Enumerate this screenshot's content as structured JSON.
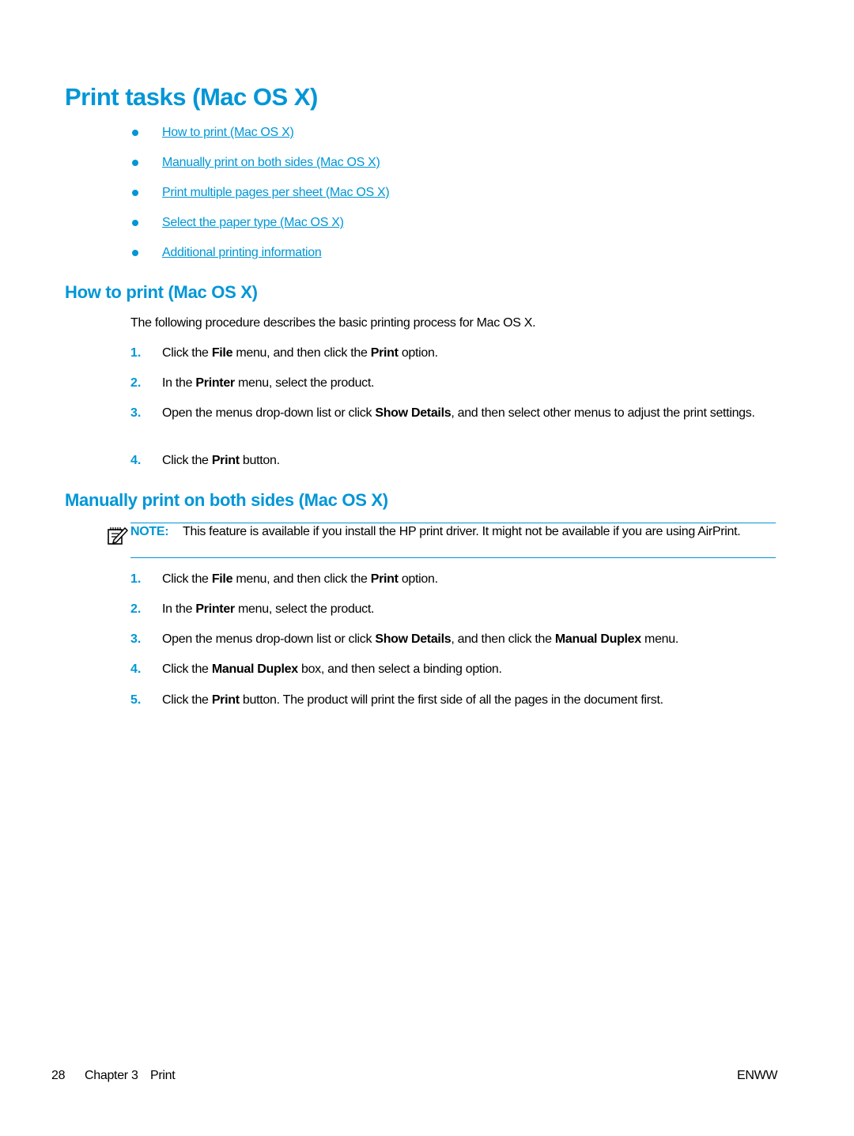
{
  "page": {
    "title": "Print tasks (Mac OS X)",
    "toc": [
      {
        "label": "How to print (Mac OS X)"
      },
      {
        "label": "Manually print on both sides (Mac OS X)"
      },
      {
        "label": "Print multiple pages per sheet (Mac OS X)"
      },
      {
        "label": "Select the paper type (Mac OS X)"
      },
      {
        "label": "Additional printing information"
      }
    ]
  },
  "section1": {
    "heading": "How to print (Mac OS X)",
    "intro": "The following procedure describes the basic printing process for Mac OS X.",
    "steps": [
      {
        "num": "1.",
        "parts": [
          [
            "Click the ",
            false
          ],
          [
            "File",
            true
          ],
          [
            " menu, and then click the ",
            false
          ],
          [
            "Print",
            true
          ],
          [
            " option.",
            false
          ]
        ]
      },
      {
        "num": "2.",
        "parts": [
          [
            "In the ",
            false
          ],
          [
            "Printer",
            true
          ],
          [
            " menu, select the product.",
            false
          ]
        ]
      },
      {
        "num": "3.",
        "parts": [
          [
            "Open the menus drop-down list or click ",
            false
          ],
          [
            "Show Details",
            true
          ],
          [
            ", and then select other menus to adjust the print settings.",
            false
          ]
        ]
      },
      {
        "num": "4.",
        "parts": [
          [
            "Click the ",
            false
          ],
          [
            "Print",
            true
          ],
          [
            " button.",
            false
          ]
        ]
      }
    ]
  },
  "section2": {
    "heading": "Manually print on both sides (Mac OS X)",
    "note": {
      "label": "NOTE:",
      "text": "This feature is available if you install the HP print driver. It might not be available if you are using AirPrint.",
      "icon": "note-pencil-icon"
    },
    "steps": [
      {
        "num": "1.",
        "parts": [
          [
            "Click the ",
            false
          ],
          [
            "File",
            true
          ],
          [
            " menu, and then click the ",
            false
          ],
          [
            "Print",
            true
          ],
          [
            " option.",
            false
          ]
        ]
      },
      {
        "num": "2.",
        "parts": [
          [
            "In the ",
            false
          ],
          [
            "Printer",
            true
          ],
          [
            " menu, select the product.",
            false
          ]
        ]
      },
      {
        "num": "3.",
        "parts": [
          [
            "Open the menus drop-down list or click ",
            false
          ],
          [
            "Show Details",
            true
          ],
          [
            ", and then click the ",
            false
          ],
          [
            "Manual Duplex",
            true
          ],
          [
            " menu.",
            false
          ]
        ]
      },
      {
        "num": "4.",
        "parts": [
          [
            "Click the ",
            false
          ],
          [
            "Manual Duplex",
            true
          ],
          [
            " box, and then select a binding option.",
            false
          ]
        ]
      },
      {
        "num": "5.",
        "parts": [
          [
            "Click the ",
            false
          ],
          [
            "Print",
            true
          ],
          [
            " button. The product will print the first side of all the pages in the document first.",
            false
          ]
        ]
      }
    ]
  },
  "footer": {
    "page_number": "28",
    "chapter": "Chapter 3",
    "chapter_title": "Print",
    "locale": "ENWW"
  },
  "colors": {
    "accent": "#0096d6",
    "text": "#000000"
  }
}
